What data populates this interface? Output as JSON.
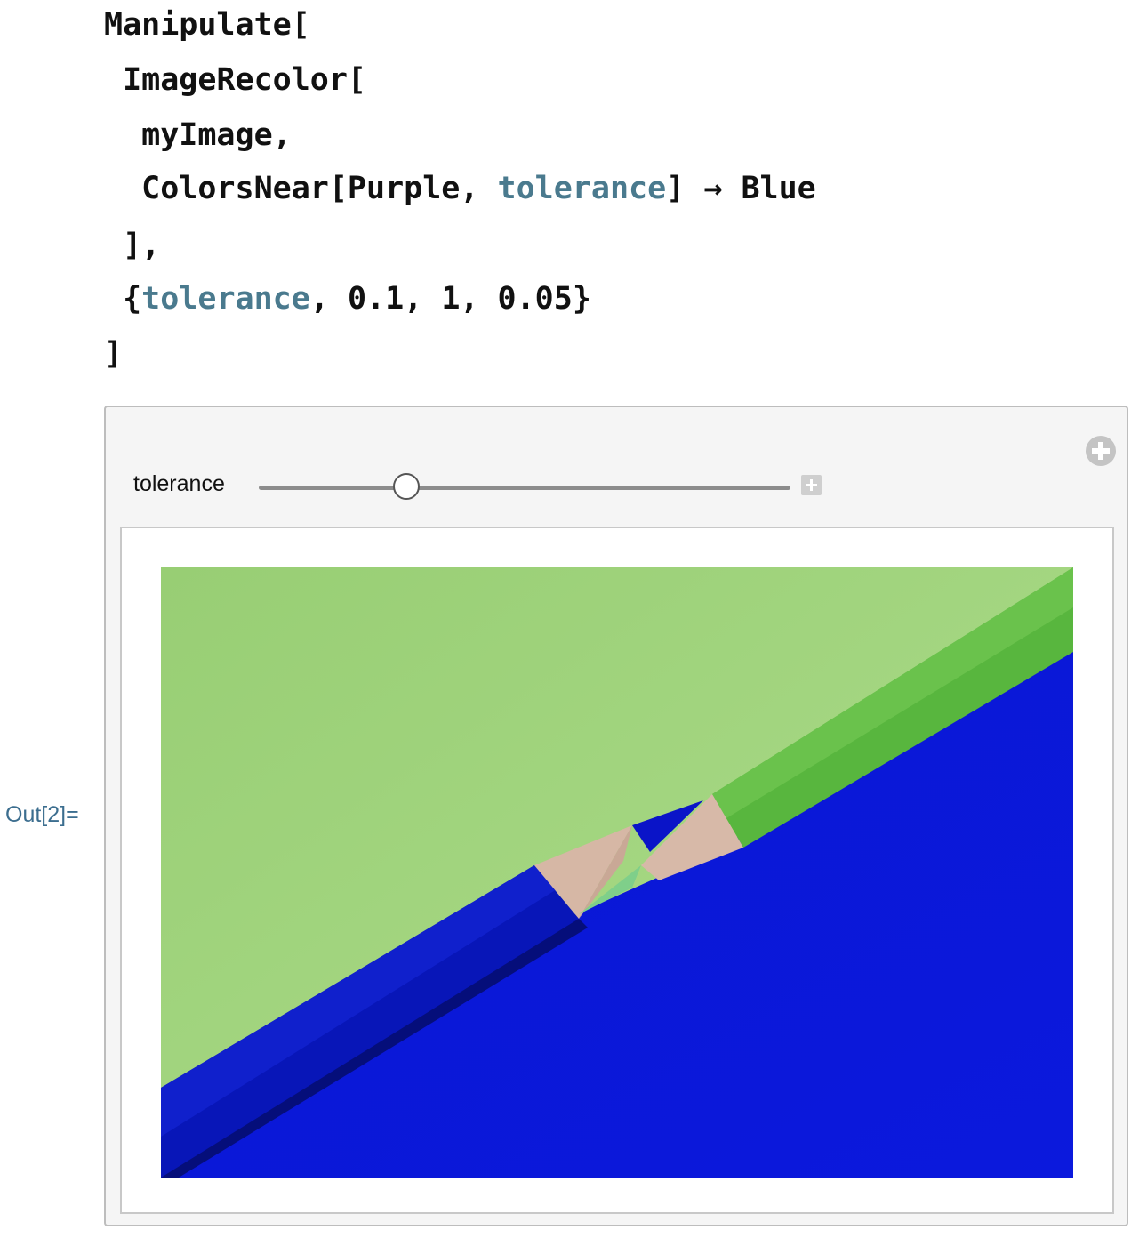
{
  "code": {
    "line1": "Manipulate[",
    "line2": " ImageRecolor[",
    "line3": "  myImage,",
    "line4_a": "  ColorsNear[Purple, ",
    "line4_var": "tolerance",
    "line4_b": "] → Blue",
    "line5": " ],",
    "line6_a": " {",
    "line6_var": "tolerance",
    "line6_b": ", 0.1, 1, 0.05}",
    "line7": "]"
  },
  "output": {
    "label": "Out[2]=",
    "control_label": "tolerance",
    "slider": {
      "min": 0.1,
      "max": 1,
      "step": 0.05,
      "value": 0.35
    }
  },
  "image": {
    "description_icon": "recolored-pencils-image",
    "colors": {
      "background_green": "#a3d67f",
      "blue": "#0c17d8",
      "pencil_green": "#56b33c",
      "wood": "#d8b8a6"
    }
  },
  "colors": {
    "variable": "#4a7a8e",
    "out_label": "#3c6e8f"
  }
}
